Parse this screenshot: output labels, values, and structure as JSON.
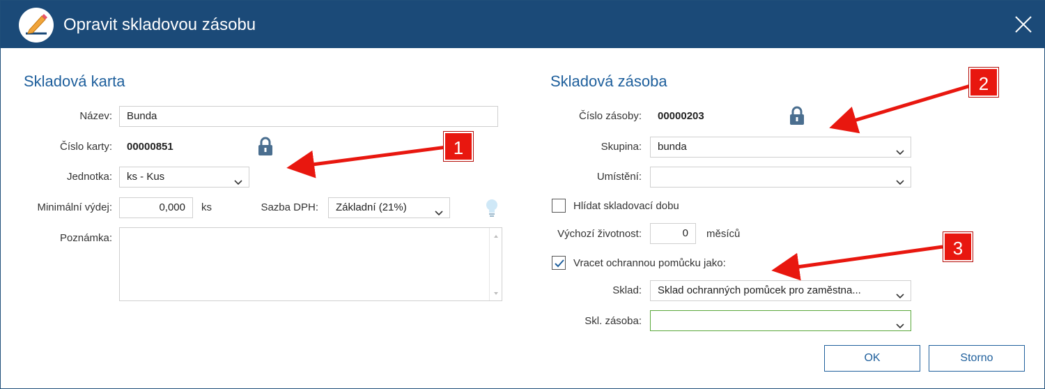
{
  "window": {
    "title": "Opravit skladovou zásobu"
  },
  "left": {
    "heading": "Skladová karta",
    "nazev_label": "Název:",
    "nazev_value": "Bunda",
    "cislo_karty_label": "Číslo karty:",
    "cislo_karty_value": "00000851",
    "jednotka_label": "Jednotka:",
    "jednotka_value": "ks - Kus",
    "min_vydej_label": "Minimální výdej:",
    "min_vydej_value": "0,000",
    "min_vydej_unit": "ks",
    "sazba_label": "Sazba DPH:",
    "sazba_value": "Základní (21%)",
    "poznamka_label": "Poznámka:",
    "poznamka_value": ""
  },
  "right": {
    "heading": "Skladová zásoba",
    "cislo_zasoby_label": "Číslo zásoby:",
    "cislo_zasoby_value": "00000203",
    "skupina_label": "Skupina:",
    "skupina_value": "bunda",
    "umisteni_label": "Umístění:",
    "umisteni_value": "",
    "hlidat_label": "Hlídat skladovací dobu",
    "hlidat_checked": false,
    "zivotnost_label": "Výchozí životnost:",
    "zivotnost_value": "0",
    "zivotnost_unit": "měsíců",
    "vracet_label": "Vracet ochrannou pomůcku jako:",
    "vracet_checked": true,
    "sklad_label": "Sklad:",
    "sklad_value": "Sklad ochranných pomůcek pro zaměstna...",
    "skl_zasoba_label": "Skl. zásoba:",
    "skl_zasoba_value": ""
  },
  "buttons": {
    "ok": "OK",
    "storno": "Storno"
  },
  "annotations": [
    "1",
    "2",
    "3"
  ],
  "icons": {
    "app": "pencil-edit-icon",
    "close": "close-icon",
    "lock": "lock-icon",
    "hint": "lightbulb-icon",
    "chevron": "chevron-down-icon",
    "check": "checkmark-icon"
  },
  "colors": {
    "titlebar": "#1b4a78",
    "heading": "#1e5f9c",
    "annotation": "#e8170f",
    "focus_border": "#5aa83a"
  }
}
